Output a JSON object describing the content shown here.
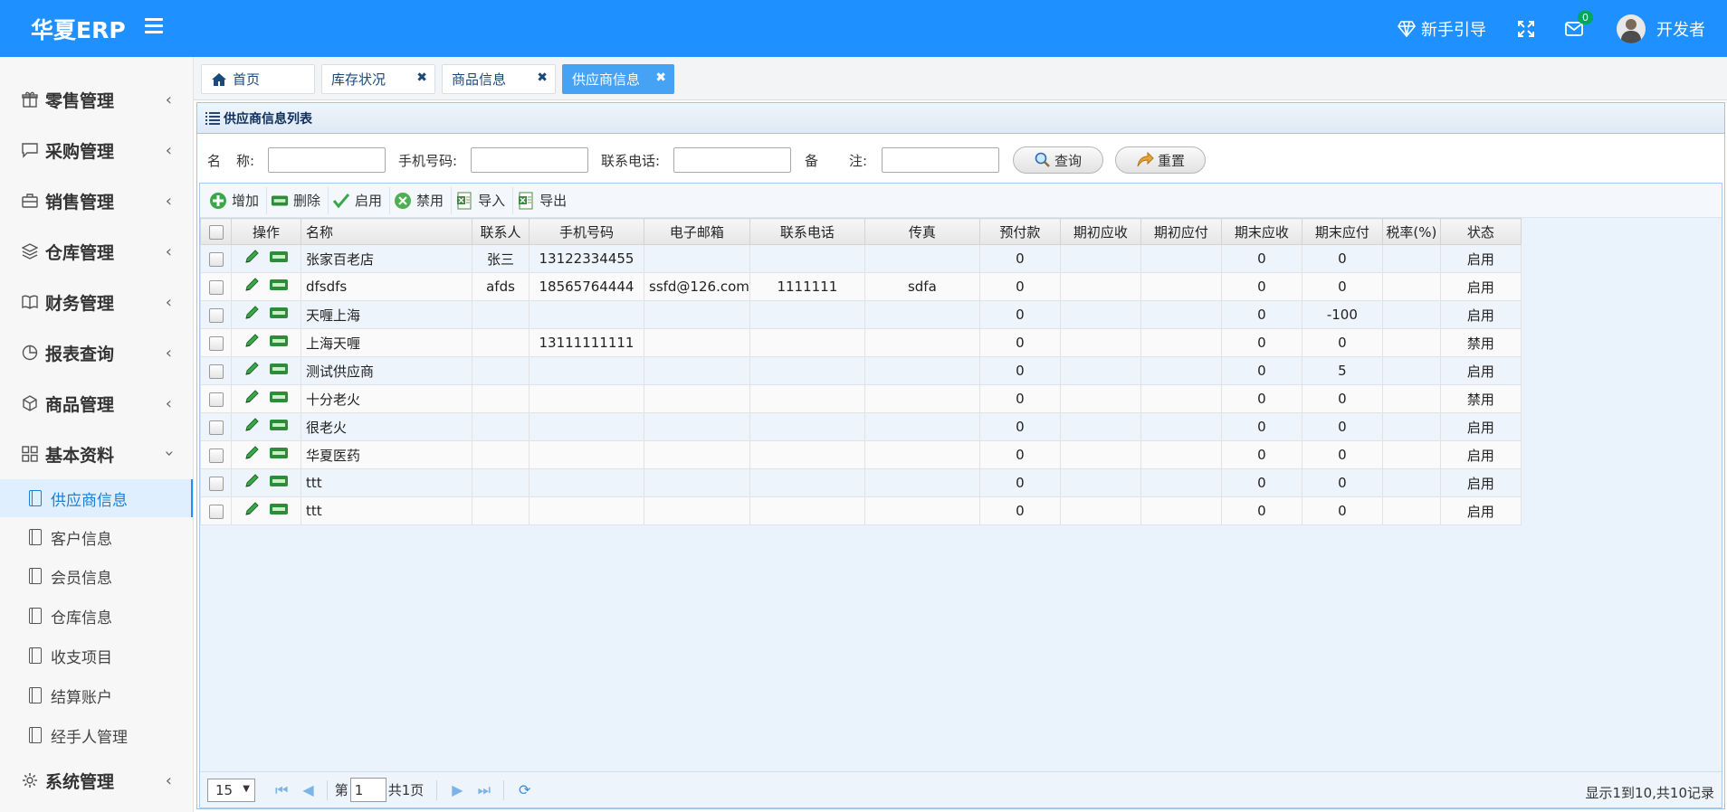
{
  "header": {
    "brand": "华夏ERP",
    "guide_label": "新手引导",
    "mail_badge": "0",
    "user_name": "开发者"
  },
  "sidebar": {
    "menus": [
      {
        "label": "零售管理",
        "icon": "gift-icon"
      },
      {
        "label": "采购管理",
        "icon": "chat-icon"
      },
      {
        "label": "销售管理",
        "icon": "briefcase-icon"
      },
      {
        "label": "仓库管理",
        "icon": "layers-icon"
      },
      {
        "label": "财务管理",
        "icon": "book-icon"
      },
      {
        "label": "报表查询",
        "icon": "pie-icon"
      },
      {
        "label": "商品管理",
        "icon": "cubes-icon"
      },
      {
        "label": "基本资料",
        "icon": "grid-icon"
      }
    ],
    "submenus": [
      {
        "label": "供应商信息",
        "active": true
      },
      {
        "label": "客户信息"
      },
      {
        "label": "会员信息"
      },
      {
        "label": "仓库信息"
      },
      {
        "label": "收支项目"
      },
      {
        "label": "结算账户"
      },
      {
        "label": "经手人管理"
      }
    ],
    "system": "系统管理"
  },
  "tabs": [
    "首页",
    "库存状况",
    "商品信息",
    "供应商信息"
  ],
  "panel": {
    "title": "供应商信息列表",
    "search": {
      "name_label_1": "名",
      "name_label_2": "称:",
      "phone_label": "手机号码:",
      "tel_label": "联系电话:",
      "remark_label_1": "备",
      "remark_label_2": "注:",
      "query_label": "查询",
      "reset_label": "重置"
    },
    "toolbar": {
      "add": "增加",
      "delete": "删除",
      "enable": "启用",
      "disable": "禁用",
      "import": "导入",
      "export": "导出"
    },
    "columns": [
      "操作",
      "名称",
      "联系人",
      "手机号码",
      "电子邮箱",
      "联系电话",
      "传真",
      "预付款",
      "期初应收",
      "期初应付",
      "期末应收",
      "期末应付",
      "税率(%)",
      "状态"
    ],
    "rows": [
      {
        "name": "张家百老店",
        "contact": "张三",
        "mobile": "13122334455",
        "email": "",
        "tel": "",
        "fax": "",
        "prepay": "0",
        "begin_recv": "",
        "begin_pay": "",
        "end_recv": "0",
        "end_pay": "0",
        "tax": "",
        "status": "启用"
      },
      {
        "name": "dfsdfs",
        "contact": "afds",
        "mobile": "18565764444",
        "email": "ssfd@126.com",
        "tel": "1111111",
        "fax": "sdfa",
        "prepay": "0",
        "begin_recv": "",
        "begin_pay": "",
        "end_recv": "0",
        "end_pay": "0",
        "tax": "",
        "status": "启用"
      },
      {
        "name": "天喱上海",
        "contact": "",
        "mobile": "",
        "email": "",
        "tel": "",
        "fax": "",
        "prepay": "0",
        "begin_recv": "",
        "begin_pay": "",
        "end_recv": "0",
        "end_pay": "-100",
        "tax": "",
        "status": "启用"
      },
      {
        "name": "上海天喱",
        "contact": "",
        "mobile": "13111111111",
        "email": "",
        "tel": "",
        "fax": "",
        "prepay": "0",
        "begin_recv": "",
        "begin_pay": "",
        "end_recv": "0",
        "end_pay": "0",
        "tax": "",
        "status": "禁用"
      },
      {
        "name": "测试供应商",
        "contact": "",
        "mobile": "",
        "email": "",
        "tel": "",
        "fax": "",
        "prepay": "0",
        "begin_recv": "",
        "begin_pay": "",
        "end_recv": "0",
        "end_pay": "5",
        "tax": "",
        "status": "启用"
      },
      {
        "name": "十分老火",
        "contact": "",
        "mobile": "",
        "email": "",
        "tel": "",
        "fax": "",
        "prepay": "0",
        "begin_recv": "",
        "begin_pay": "",
        "end_recv": "0",
        "end_pay": "0",
        "tax": "",
        "status": "禁用"
      },
      {
        "name": "很老火",
        "contact": "",
        "mobile": "",
        "email": "",
        "tel": "",
        "fax": "",
        "prepay": "0",
        "begin_recv": "",
        "begin_pay": "",
        "end_recv": "0",
        "end_pay": "0",
        "tax": "",
        "status": "启用"
      },
      {
        "name": "华夏医药",
        "contact": "",
        "mobile": "",
        "email": "",
        "tel": "",
        "fax": "",
        "prepay": "0",
        "begin_recv": "",
        "begin_pay": "",
        "end_recv": "0",
        "end_pay": "0",
        "tax": "",
        "status": "启用"
      },
      {
        "name": "ttt",
        "contact": "",
        "mobile": "",
        "email": "",
        "tel": "",
        "fax": "",
        "prepay": "0",
        "begin_recv": "",
        "begin_pay": "",
        "end_recv": "0",
        "end_pay": "0",
        "tax": "",
        "status": "启用"
      },
      {
        "name": "ttt",
        "contact": "",
        "mobile": "",
        "email": "",
        "tel": "",
        "fax": "",
        "prepay": "0",
        "begin_recv": "",
        "begin_pay": "",
        "end_recv": "0",
        "end_pay": "0",
        "tax": "",
        "status": "启用"
      }
    ],
    "pager": {
      "page_size": "15",
      "page_prefix": "第",
      "page_value": "1",
      "page_suffix": "共1页",
      "info": "显示1到10,共10记录"
    }
  },
  "colors": {
    "header_bg": "#1e90ff",
    "active_tab": "#46a2f5",
    "sidebar_active_bg": "#dfeffd"
  }
}
